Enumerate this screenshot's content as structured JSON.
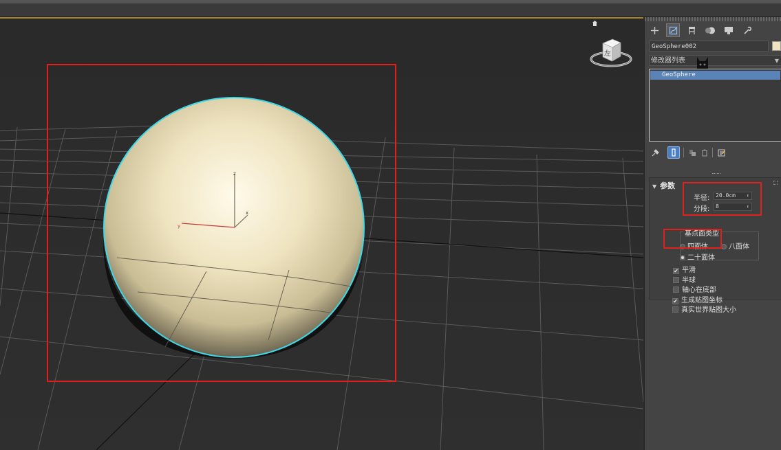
{
  "viewport": {
    "viewcube_face_label": "左",
    "axis_labels": {
      "z": "z",
      "x": "x",
      "y": "y"
    }
  },
  "command_panel": {
    "tab_icons": [
      "create-tab",
      "modify-tab",
      "hierarchy-tab",
      "motion-tab",
      "display-tab",
      "utilities-tab"
    ],
    "object_name": "GeoSphere002",
    "object_color": "#f1e3bd",
    "modifier_list_label": "修改器列表",
    "modifier_stack": [
      {
        "label": "GeoSphere",
        "selected": true
      }
    ],
    "stack_tools": [
      "pin-stack",
      "show-end-result",
      "make-unique",
      "remove-modifier",
      "configure-modifier-sets"
    ]
  },
  "parameters": {
    "rollout_title": "参数",
    "radius_label": "半径:",
    "radius_value": "20.0cm",
    "segments_label": "分段:",
    "segments_value": "8",
    "base_type_label": "基点面类型",
    "base_types": [
      {
        "label": "四面体",
        "selected": false
      },
      {
        "label": "八面体",
        "selected": false
      },
      {
        "label": "二十面体",
        "selected": true
      }
    ],
    "checkboxes": [
      {
        "label": "平滑",
        "checked": true
      },
      {
        "label": "半球",
        "checked": false
      },
      {
        "label": "轴心在底部",
        "checked": false
      },
      {
        "label": "生成贴图坐标",
        "checked": true
      },
      {
        "label": "真实世界贴图大小",
        "checked": false
      }
    ]
  },
  "colors": {
    "highlight_red": "#e0201c",
    "selection_cyan": "#3fd8e8",
    "stack_selected": "#5a83b8"
  }
}
